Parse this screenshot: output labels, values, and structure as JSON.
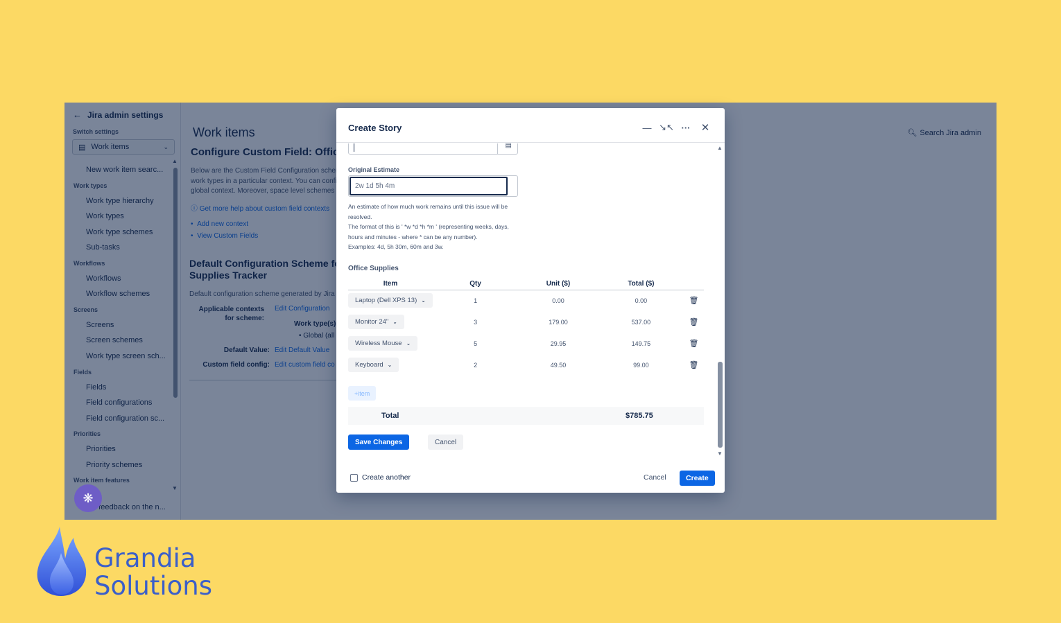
{
  "sidebar": {
    "back_label": "Jira admin settings",
    "switch_label": "Switch settings",
    "switch_value": "Work items",
    "items": [
      {
        "type": "item",
        "label": "New work item searc..."
      },
      {
        "type": "head",
        "label": "Work types"
      },
      {
        "type": "item",
        "label": "Work type hierarchy"
      },
      {
        "type": "item",
        "label": "Work types"
      },
      {
        "type": "item",
        "label": "Work type schemes"
      },
      {
        "type": "item",
        "label": "Sub-tasks"
      },
      {
        "type": "head",
        "label": "Workflows"
      },
      {
        "type": "item",
        "label": "Workflows"
      },
      {
        "type": "item",
        "label": "Workflow schemes"
      },
      {
        "type": "head",
        "label": "Screens"
      },
      {
        "type": "item",
        "label": "Screens"
      },
      {
        "type": "item",
        "label": "Screen schemes"
      },
      {
        "type": "item",
        "label": "Work type screen sch..."
      },
      {
        "type": "head",
        "label": "Fields"
      },
      {
        "type": "item",
        "label": "Fields"
      },
      {
        "type": "item",
        "label": "Field configurations"
      },
      {
        "type": "item",
        "label": "Field configuration sc..."
      },
      {
        "type": "head",
        "label": "Priorities"
      },
      {
        "type": "item",
        "label": "Priorities"
      },
      {
        "type": "item",
        "label": "Priority schemes"
      },
      {
        "type": "head",
        "label": "Work item features"
      }
    ],
    "feedback": "e feedback on the n..."
  },
  "main": {
    "title": "Work items",
    "search": "Search Jira admin",
    "config_heading": "Configure Custom Field: Office",
    "description": "Below are the Custom Field Configuration schem work types in a particular context. You can confi global context. Moreover, space level schemes w",
    "help_link": "Get more help about custom field contexts",
    "links": [
      "Add new context",
      "View Custom Fields"
    ],
    "default_heading": "Default Configuration Scheme fo Supplies Tracker",
    "default_desc": "Default configuration scheme generated by Jira",
    "contexts_label": "Applicable contexts for scheme:",
    "contexts_link": "Edit Configuration",
    "work_types_label": "Work type(s):",
    "work_types_value": "Global (all",
    "default_value_label": "Default Value:",
    "default_value_link": "Edit Default Value",
    "custom_config_label": "Custom field config:",
    "custom_config_link": "Edit custom field co"
  },
  "modal": {
    "title": "Create Story",
    "original_estimate_label": "Original Estimate",
    "original_estimate_value": "2w 1d 5h 4m",
    "help_lines": [
      "An estimate of how much work remains until this issue will be resolved.",
      "The format of this is ' *w *d *h *m ' (representing weeks, days, hours and minutes - where * can be any number).",
      "Examples: 4d, 5h 30m, 60m and 3w."
    ],
    "section_title": "Office Supplies",
    "columns": [
      "Item",
      "Qty",
      "Unit ($)",
      "Total ($)"
    ],
    "rows": [
      {
        "item": "Laptop (Dell XPS 13)",
        "qty": "1",
        "unit": "0.00",
        "total": "0.00"
      },
      {
        "item": "Monitor 24\"",
        "qty": "3",
        "unit": "179.00",
        "total": "537.00"
      },
      {
        "item": "Wireless Mouse",
        "qty": "5",
        "unit": "29.95",
        "total": "149.75"
      },
      {
        "item": "Keyboard",
        "qty": "2",
        "unit": "49.50",
        "total": "99.00"
      }
    ],
    "add_item": "+item",
    "total_label": "Total",
    "total_value": "$785.75",
    "save_label": "Save Changes",
    "cancel_inner": "Cancel",
    "create_another": "Create another",
    "footer_cancel": "Cancel",
    "footer_create": "Create"
  },
  "brand": {
    "line1": "Grandia",
    "line2": "Solutions"
  },
  "colors": {
    "background": "#fcd964",
    "primary": "#0c66e4",
    "brand_text": "#3b5fc9",
    "ai_bubble": "#6e5dc6"
  }
}
